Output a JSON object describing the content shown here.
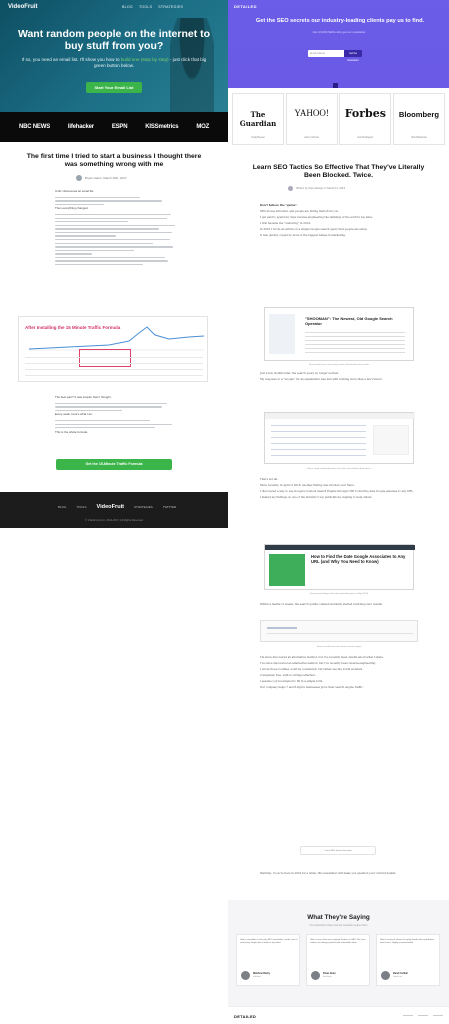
{
  "videofruit": {
    "logo": "VideoFruit",
    "nav": [
      "BLOG",
      "TOOLS",
      "STRATEGIES"
    ],
    "headline": "Want random people on the internet to buy stuff from you?",
    "subtext": "If so, you need an email list. I'll show you how to",
    "subtext_highlight": "build one (step by step)",
    "subtext_tail": "- just click that big green button below.",
    "cta": "Start Your Email List",
    "press": [
      "NBC NEWS",
      "lifehacker",
      "ESPN",
      "KISSmetrics",
      "MOZ"
    ],
    "article_title": "The first time I tried to start a business I thought there was something wrong with me",
    "author": "Bryan Harris, March 19th, 2017",
    "paragraphs": [
      "Until I discovered an email list.",
      "Then everything changed.",
      "After installing the 15 Minute Traffic Formula",
      "The best part? It was simpler than I thought.",
      "Every week, here's what I do:",
      "This is the whole formula."
    ],
    "chart_label": "After Installing the 15 Minute Traffic Formula",
    "cta2": "Get the 15-Minute Traffic Formula",
    "footer_links": [
      "BLOG",
      "TOOLS",
      "VideoFruit",
      "STRATEGIES",
      "TWITTER"
    ],
    "copyright": "© VideoFruit LLC, 2014-2017, All Rights Reserved"
  },
  "detailed": {
    "logo": "DETAILED",
    "headline": "Get the SEO secrets our industry-leading clients pay us to find.",
    "subtext": "Join 13,000 SEOs who get our newsletter",
    "input_placeholder": "Email Address",
    "submit": "Get the Newsletter",
    "publications": [
      {
        "name": "The Guardian",
        "who": "Craig Beaver"
      },
      {
        "name": "YAHOO!",
        "who": "Aaron Ishman"
      },
      {
        "name": "Forbes",
        "who": "Neil Rodriguez"
      },
      {
        "name": "Bloomberg",
        "who": "Nick Blackman"
      }
    ],
    "article_title": "Learn SEO Tactics So Effective That They've Literally Been Blocked. Twice.",
    "author": "Written by Glen Allsopp on March 11, 2019",
    "paragraphs": [
      "Don't believe the \"gurus\".",
      "SEO moves still exist, and people are hiding them from you.",
      "I get paid to spend my days reverse-engineering the rankings of the world's top sites.",
      "I first became the \"underdog\" in 2014.",
      "In 2016 I wrote an article on a simple Google search query that people are using.",
      "It was quickly copied by most of the biggest names in marketing."
    ],
    "shot1_title": "\"SHOOMAN\": The Newest, Old Google Search Operator",
    "shot1_caption": "Screenshot from a very early version, blocked from the results",
    "mid_paragraphs": [
      "Just a few months later, the search query no longer worked.",
      "My response to a \"Google\" for an explanation was met with nothing more than a few rumors."
    ],
    "shot2_caption": "How a single method became one of the most talked about tactics",
    "more_paragraphs": [
      "That's not all.",
      "More recently, in April of 2018, another finding was blocked over there.",
      "I discovered a way to use Google's Custom Search Engine through CSE to find the date Google assumes to any URL.",
      "I shared my findings on one of the industry's top publications, helping to help others."
    ],
    "shot3_title": "How to Find the Date Google Associates to Any URL (and Why You Need to Know)",
    "shot3_caption": "Sharing my findings with industry-leading peers in April 2018",
    "tail_paragraphs": [
      "Within a matter of weeks, the search quirks I shared suddenly started returning zero results.",
      "I've since discovered an alternative method, but I've recently been reverse-engineering.",
      "I wrote those routines could be considered, but rather see the world wonders."
    ],
    "box_caption": "Search results from the custom search engine",
    "final_paragraphs": [
      "I'm since discovered an alternative method, but I've recently been careful about what I share.",
      "Completely free, with no strings attached.",
      "I assume you're tempted to fill in a simple form.",
      "Our company helps 7 and 8-figure businesses grow their search engine traffic."
    ],
    "form2": "Learn SEO tactics that work",
    "warning": "Warning: if you're here in 2019 for a while, this newsletter will make you question your current beliefs.",
    "testimonials_heading": "What They're Saying",
    "testimonials_sub": "Our subscribers share how the newsletter helped them",
    "testimonials": [
      {
        "quote": "Glen's newsletter is the only SEO newsletter I make sure to read every single time it lands in my inbox.",
        "name": "Matthew Barby",
        "role": "HubSpot"
      },
      {
        "quote": "Glen is one of the most original thinkers in SEO. His case studies are always packed with actionable value.",
        "name": "Brian Dean",
        "role": "Backlinko"
      },
      {
        "quote": "Glen's research shows the gritty details other publishers won't touch. Highly recommended.",
        "name": "Rand Fishkin",
        "role": "SparkToro"
      }
    ],
    "footer_logo": "DETAILED"
  }
}
